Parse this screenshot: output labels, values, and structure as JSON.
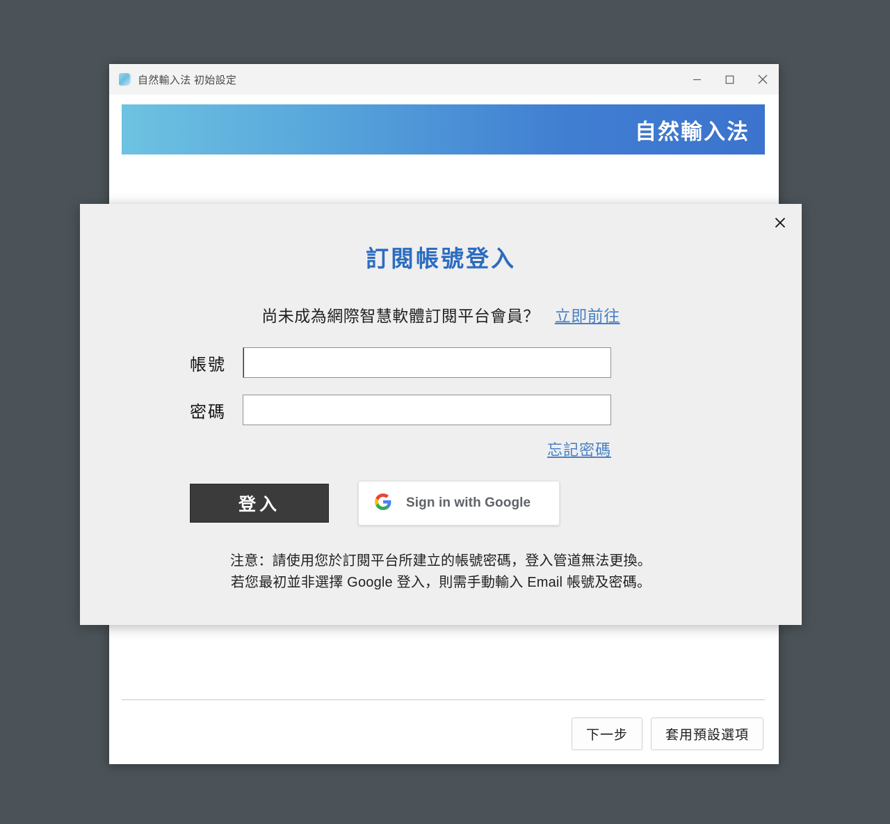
{
  "window": {
    "title": "自然輸入法 初始設定",
    "icon": "app-icon",
    "controls": {
      "minimize": "minimize-icon",
      "maximize": "maximize-icon",
      "close": "close-icon"
    },
    "banner": {
      "title": "自然輸入法",
      "gradient_from": "#6ec2e1",
      "gradient_to": "#3b73ce"
    },
    "footer": {
      "next_label": "下一步",
      "defaults_label": "套用預設選項"
    }
  },
  "modal": {
    "close_icon": "close-icon",
    "title": "訂閱帳號登入",
    "title_color": "#2c6cc0",
    "subtitle": {
      "text": "尚未成為網際智慧軟體訂閱平台會員？",
      "link_label": "立即前往",
      "link_color": "#4a80c4"
    },
    "form": {
      "account_label": "帳號",
      "account_value": "",
      "account_placeholder": "",
      "password_label": "密碼",
      "password_value": "",
      "password_placeholder": "",
      "forgot_label": "忘記密碼"
    },
    "actions": {
      "login_label": "登入",
      "google_label": "Sign in with Google",
      "google_icon": "google-g-icon"
    },
    "notice": {
      "line1": "注意：請使用您於訂閱平台所建立的帳號密碼，登入管道無法更換。",
      "line2": "若您最初並非選擇 Google 登入，則需手動輸入 Email 帳號及密碼。"
    }
  },
  "theme": {
    "desktop_background": "#4b5358",
    "modal_background": "#efefef",
    "login_button_background": "#3b3b3b"
  }
}
